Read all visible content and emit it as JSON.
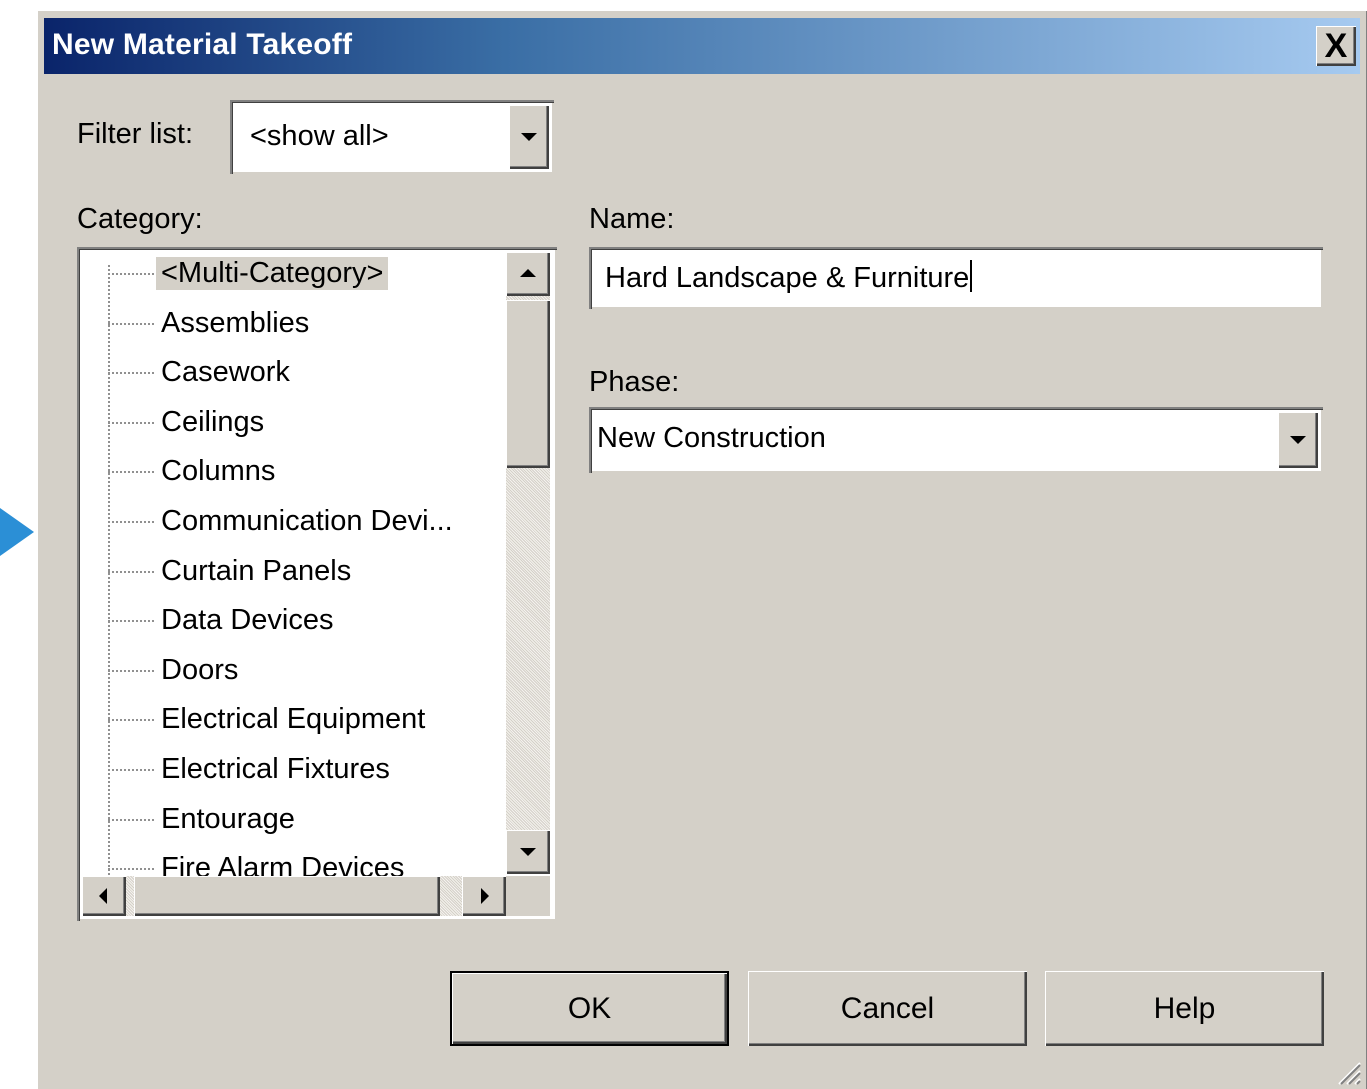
{
  "dialog": {
    "title": "New Material Takeoff",
    "close_label": "X"
  },
  "filter": {
    "label": "Filter list:",
    "value": "<show all>"
  },
  "category": {
    "label": "Category:",
    "items": [
      "<Multi-Category>",
      "Assemblies",
      "Casework",
      "Ceilings",
      "Columns",
      "Communication Devi...",
      "Curtain Panels",
      "Data Devices",
      "Doors",
      "Electrical Equipment",
      "Electrical Fixtures",
      "Entourage",
      "Fire Alarm Devices"
    ],
    "selected_index": 0
  },
  "name": {
    "label": "Name:",
    "value": "Hard Landscape & Furniture"
  },
  "phase": {
    "label": "Phase:",
    "value": "New Construction"
  },
  "buttons": {
    "ok": "OK",
    "cancel": "Cancel",
    "help": "Help"
  },
  "colors": {
    "title_gradient_start": "#0a246a",
    "title_gradient_end": "#a6caf0",
    "dialog_face": "#d4d0c8",
    "pointer_arrow": "#2b8fd6"
  }
}
